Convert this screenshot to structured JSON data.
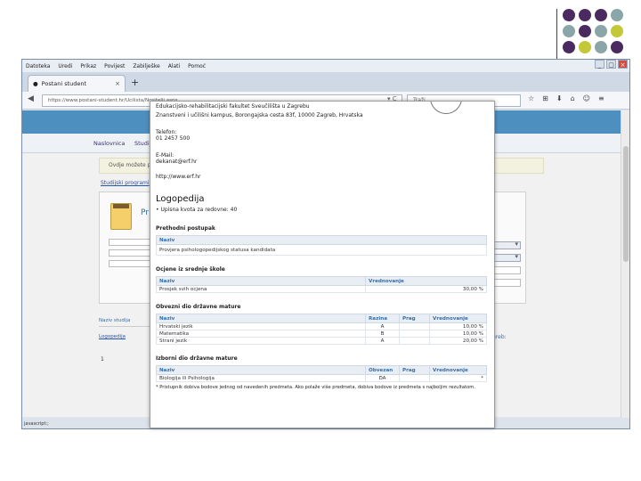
{
  "decor": {
    "dot_colors": [
      "#4b2a5f",
      "#4b2a5f",
      "#4b2a5f",
      "#8aa6a8",
      "#8aa6a8",
      "#4b2a5f",
      "#8aa6a8",
      "#c2c837",
      "#4b2a5f",
      "#c2c837",
      "#8aa6a8",
      "#4b2a5f"
    ]
  },
  "browser": {
    "menu": [
      "Datoteka",
      "Uredi",
      "Prikaz",
      "Povijest",
      "Zabilješke",
      "Alati",
      "Pomoć"
    ],
    "tab_title": "Postani student",
    "tab_close": "×",
    "new_tab": "+",
    "url": "https://www.postani-student.hr/Ucilista/Nositelji.aspx",
    "url_controls": "▾ C",
    "search_placeholder": "Traži",
    "tool_icons": [
      "☆",
      "⊞",
      "⬇",
      "⌂",
      "☺",
      "≡"
    ],
    "win_controls": [
      "_",
      "▢",
      "×"
    ],
    "status": "javascript:;"
  },
  "site": {
    "menu": [
      "Naslovnica",
      "Studiji"
    ],
    "info_text": "Ovdje možete pregledati…",
    "link_text": "Studijski programi",
    "panel_title": "Pr",
    "study_header": "Naziv studija",
    "study_link": "Logopedija",
    "study_right": "greb:",
    "page_number": "1"
  },
  "doc": {
    "header_line": "Edukacijsko-rehabilitacijski fakultet Sveučilišta u Zagrebu",
    "address": "Znanstveni i učilišni kampus, Borongajska cesta 83f, 10000 Zagreb, Hrvatska",
    "phone_label": "Telefon:",
    "phone": "01 2457 500",
    "email_label": "E-Mail:",
    "email": "dekanat@erf.hr",
    "website": "http://www.erf.hr",
    "program_title": "Logopedija",
    "quota": "Upisna kvota za redovne: 40",
    "sections": {
      "preliminary": {
        "title": "Prethodni postupak",
        "headers": [
          "Naziv"
        ],
        "rows": [
          [
            "Provjera psihologopedijskog statusa kandidata"
          ]
        ]
      },
      "high_school": {
        "title": "Ocjene iz srednje škole",
        "headers": [
          "Naziv",
          "Vrednovanje"
        ],
        "rows": [
          [
            "Prosjek svih ocjena",
            "30,00 %"
          ]
        ]
      },
      "mandatory": {
        "title": "Obvezni dio državne mature",
        "headers": [
          "Naziv",
          "Razina",
          "Prag",
          "Vrednovanje"
        ],
        "rows": [
          [
            "Hrvatski jezik",
            "A",
            "",
            "10,00 %"
          ],
          [
            "Matematika",
            "B",
            "",
            "10,00 %"
          ],
          [
            "Strani jezik",
            "A",
            "",
            "20,00 %"
          ]
        ]
      },
      "elective": {
        "title": "Izborni dio državne mature",
        "headers": [
          "Naziv",
          "Obvezan",
          "Prag",
          "Vrednovanje"
        ],
        "rows": [
          [
            "Biologija ili Psihologija",
            "DA",
            "",
            "*"
          ]
        ]
      }
    },
    "footnote": "* Pristupnik dobiva bodove jednog od navedenih predmeta. Ako polaže više predmeta, dobiva bodove iz predmeta s najboljim rezultatom."
  }
}
